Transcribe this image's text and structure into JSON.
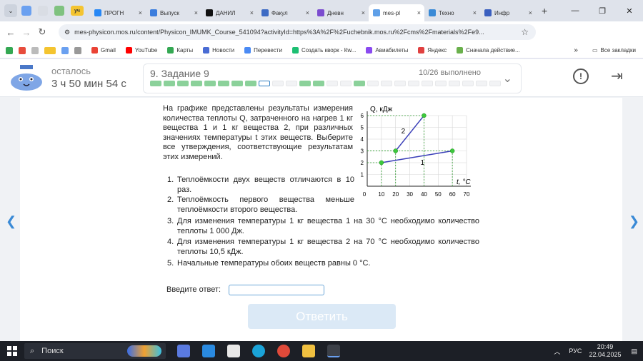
{
  "browser": {
    "pins": [
      "",
      "",
      "",
      "уч"
    ],
    "tabs": [
      {
        "label": "ПРОГН",
        "fav": "vk",
        "active": false
      },
      {
        "label": "Выпуск",
        "fav": "ed",
        "active": false
      },
      {
        "label": "ДАНИЛ",
        "fav": "W",
        "active": false
      },
      {
        "label": "Факул",
        "fav": "fk",
        "active": false
      },
      {
        "label": "Дневн",
        "fav": "Э",
        "active": false
      },
      {
        "label": "mes-pl",
        "fav": "cloud",
        "active": true
      },
      {
        "label": "Техно",
        "fav": "tech",
        "active": false
      },
      {
        "label": "Инфр",
        "fav": "inf",
        "active": false
      }
    ],
    "url": "mes-physicon.mos.ru/content/Physicon_IMUMK_Course_541094?activityId=https%3A%2F%2Fuchebnik.mos.ru%2Fcms%2Fmaterials%2Fe9...",
    "bookmarks": [
      "Gmail",
      "YouTube",
      "Карты",
      "Новости",
      "Перевести",
      "Создать кворк - Кw...",
      "Авиабилеты",
      "Яндекс",
      "Сначала действие..."
    ],
    "bookmarks_more": "»",
    "all_bookmarks": "Все закладки"
  },
  "header": {
    "remaining_label": "осталось",
    "timer": "3 ч 50 мин 54 с",
    "task_title": "9. Задание 9",
    "done": "10/26 выполнено",
    "progress": [
      "g",
      "g",
      "g",
      "g",
      "g",
      "g",
      "g",
      "g",
      "cur",
      "e",
      "e",
      "g",
      "g",
      "e",
      "e",
      "g",
      "e",
      "e",
      "e",
      "e",
      "e",
      "e",
      "e",
      "e",
      "e",
      "e"
    ]
  },
  "question": {
    "intro": "На графике представлены результаты измерения количества теплоты Q, затраченного на нагрев 1 кг вещества 1 и 1 кг вещества 2, при различных значениях температуры t этих веществ. Выберите все утверждения, соответствующие результатам этих измерений.",
    "items": [
      {
        "n": "1.",
        "text": "Теплоёмкости двух веществ отличаются в 10 раз."
      },
      {
        "n": "2.",
        "text": "Теплоёмкость первого вещества меньше теплоёмкости второго вещества."
      },
      {
        "n": "3.",
        "text": "Для изменения температуры 1 кг вещества 1 на 30 °С необходимо количество теплоты 1 000 Дж."
      },
      {
        "n": "4.",
        "text": "Для изменения температуры 1 кг вещества 2 на 70 °С необходимо количество теплоты 10,5 кДж."
      },
      {
        "n": "5.",
        "text": "Начальные температуры обоих веществ равны 0 °С."
      }
    ],
    "answer_label": "Введите ответ:",
    "answer_value": "",
    "submit_label": "Ответить"
  },
  "chart_data": {
    "type": "line",
    "ylabel": "Q, кДж",
    "xlabel": "t, °С",
    "x_ticks": [
      0,
      10,
      20,
      30,
      40,
      50,
      60,
      70
    ],
    "y_ticks": [
      1,
      2,
      3,
      4,
      5,
      6
    ],
    "xlim": [
      0,
      70
    ],
    "ylim": [
      0,
      6
    ],
    "grid": true,
    "series": [
      {
        "name": "1",
        "x": [
          10,
          60
        ],
        "y": [
          2,
          3
        ]
      },
      {
        "name": "2",
        "x": [
          20,
          40
        ],
        "y": [
          3,
          6
        ]
      }
    ]
  },
  "taskbar": {
    "search": "Поиск",
    "lang": "РУС",
    "time": "20:49",
    "date": "22.04.2025"
  },
  "colors": {
    "accent": "#2f7fc1",
    "done": "#8bd19a",
    "point": "#3cc83c",
    "line": "#3a3fb8"
  }
}
